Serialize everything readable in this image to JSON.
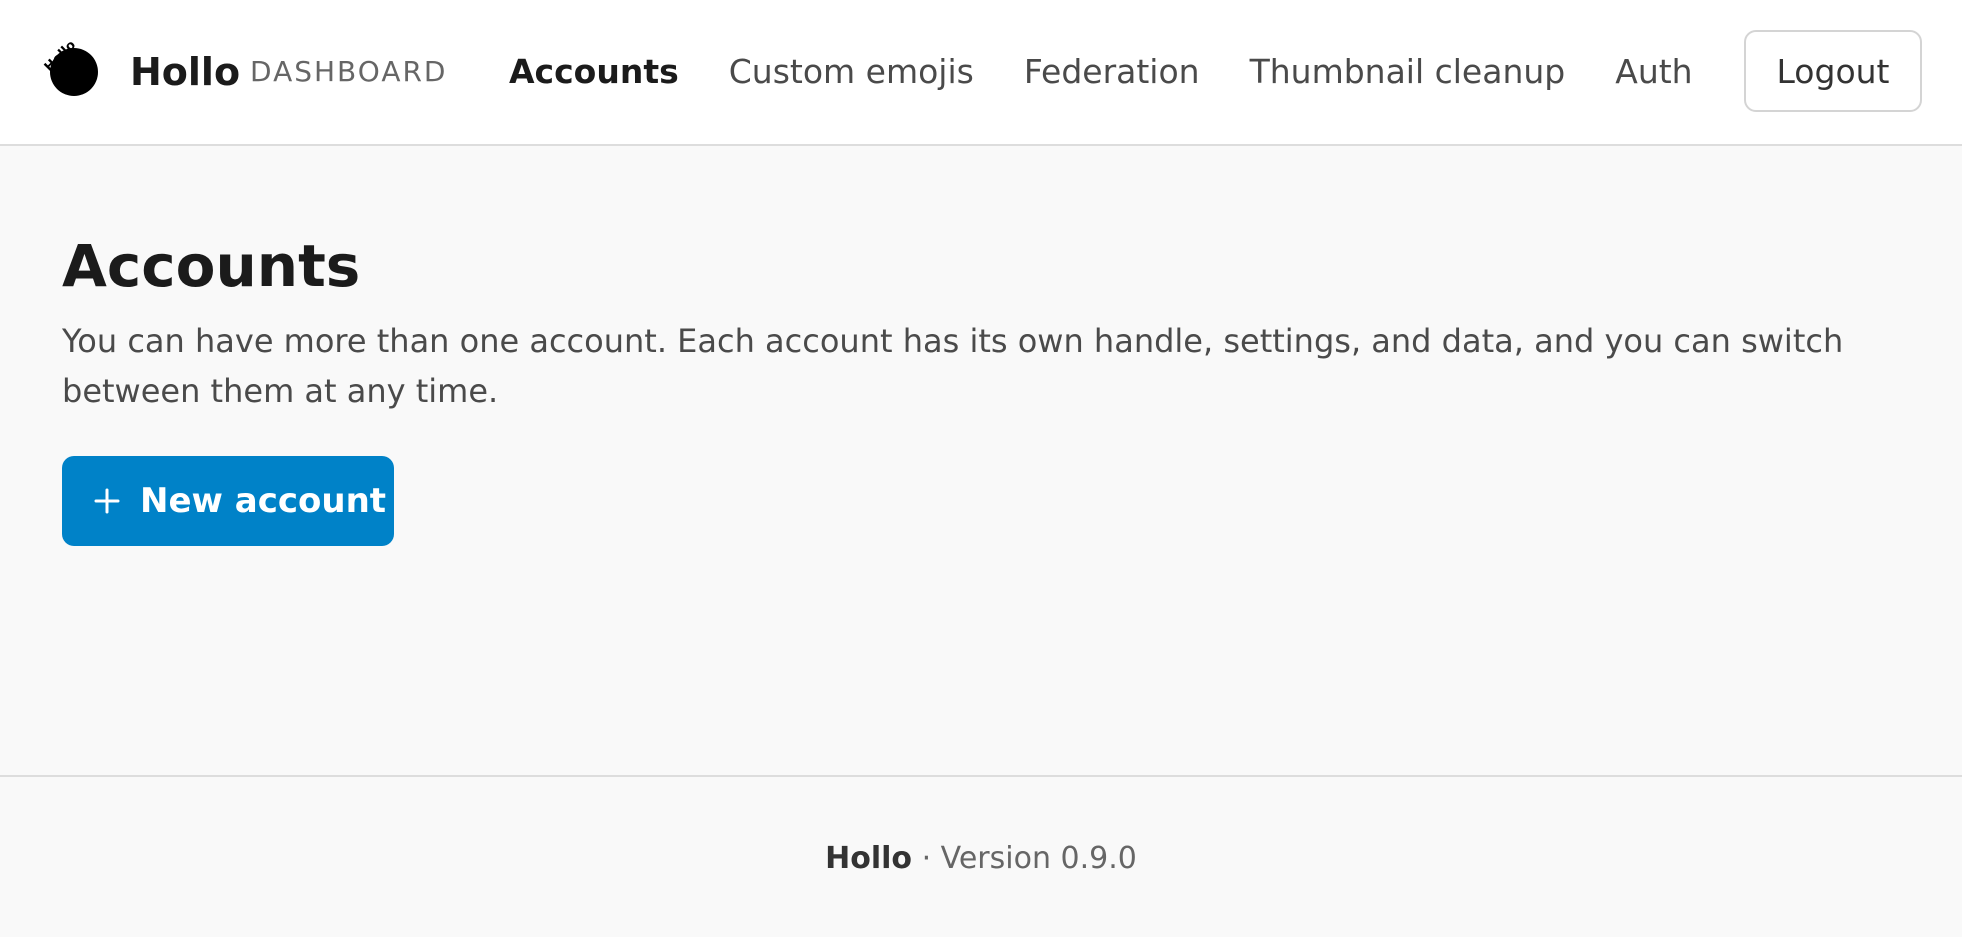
{
  "header": {
    "logo_text": "Hollo",
    "brand": "Hollo",
    "section": "DASHBOARD",
    "nav": [
      {
        "label": "Accounts",
        "active": true
      },
      {
        "label": "Custom emojis",
        "active": false
      },
      {
        "label": "Federation",
        "active": false
      },
      {
        "label": "Thumbnail cleanup",
        "active": false
      },
      {
        "label": "Auth",
        "active": false
      }
    ],
    "logout_label": "Logout"
  },
  "main": {
    "title": "Accounts",
    "description": "You can have more than one account. Each account has its own handle, settings, and data, and you can switch between them at any time.",
    "new_account_label": "New account",
    "new_account_icon": "plus-icon"
  },
  "footer": {
    "brand": "Hollo",
    "separator": " · ",
    "version": "Version 0.9.0"
  },
  "colors": {
    "accent": "#0082c8",
    "page_background": "#f9f9f9",
    "header_background": "#ffffff"
  }
}
